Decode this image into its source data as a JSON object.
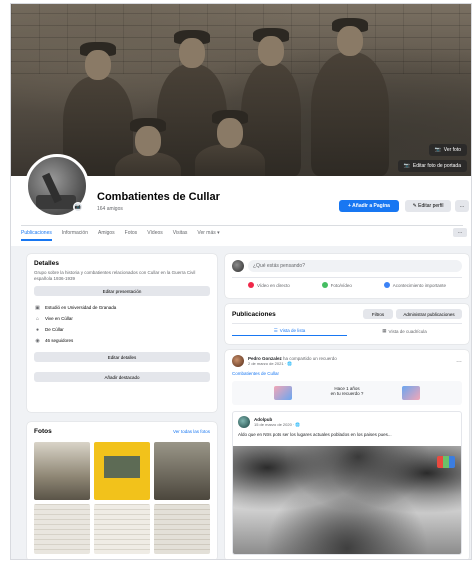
{
  "cover": {
    "edit_cover_label": "Editar foto de portada",
    "view_photo_label": "Ver foto"
  },
  "group": {
    "name": "Combatientes de Cullar",
    "members": "164 amigos"
  },
  "actions": {
    "invite_label": "+ Añadir a Pagina",
    "edit_label": "✎ Editar perfil",
    "more_label": "…"
  },
  "tabs": [
    "Publicaciones",
    "Información",
    "Amigos",
    "Fotos",
    "Vídeos",
    "Visitas",
    "Ver más ▾"
  ],
  "about": {
    "title": "Detalles",
    "description": "Grupo sobre la historia y combatientes relacionados con Cullar en la Guerra Civil española 1936-1939",
    "add_bio_label": "Editar presentación",
    "info_rows": [
      {
        "icon": "briefcase-icon",
        "text": "Estudió en Universidad de Granada"
      },
      {
        "icon": "home-icon",
        "text": "Vive en Cúllar"
      },
      {
        "icon": "pin-icon",
        "text": "De Cúllar"
      },
      {
        "icon": "followers-icon",
        "text": "46 seguidores"
      }
    ],
    "edit_details_label": "Editar detalles",
    "add_featured_label": "Añadir destacado"
  },
  "photos": {
    "title": "Fotos",
    "see_all_label": "Ver todas las fotos"
  },
  "composer": {
    "placeholder": "¿Qué estás pensando?",
    "actions": [
      "Vídeo en directo",
      "Foto/vídeo",
      "Acontecimiento importante"
    ]
  },
  "publications": {
    "title": "Publicaciones",
    "filters_label": "Filtros",
    "manage_label": "Administrar publicaciones",
    "list_view_label": "Vista de lista",
    "grid_view_label": "Vista de cuadrícula"
  },
  "post": {
    "author": "Pedro Gonzalez",
    "author_suffix": "ha compartido un recuerdo",
    "date": "2 de marzo de 2021 · 🌐",
    "link": "Combatientes de Cullar",
    "memory_text": "Hace 1 años\nen tu recuerdo ?",
    "inner_author": "Adolpub",
    "inner_date": "15 de marzo de 2020 · 🌐",
    "inner_text": "Aldo que en Ntrs pots ser los lugares actuales poblados en los paises pues..."
  }
}
